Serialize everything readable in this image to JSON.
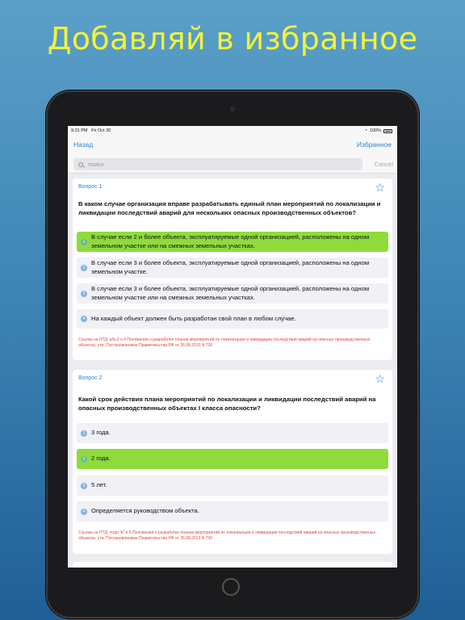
{
  "promo": {
    "title": "Добавляй в избранное"
  },
  "status_bar": {
    "time": "9:31 PM",
    "date": "Fri Oct 30",
    "battery": "100%"
  },
  "nav": {
    "back": "Назад",
    "favorites": "Избранное"
  },
  "search": {
    "placeholder": "поиск",
    "cancel": "Cancel"
  },
  "questions": [
    {
      "number": "Вопрос 1",
      "text": "В каком случае организация вправе разрабатывать единый план мероприятий по локализации и ликвидации последствий аварий для нескольких опасных производственных объектов?",
      "answers": [
        {
          "n": "1",
          "text": "В случае если 2 и более объекта, эксплуатируемые одной организацией, расположены на одном земельном участке или на смежных земельных участках.",
          "correct": true
        },
        {
          "n": "2",
          "text": "В случае если 3 и более объекта, эксплуатируемые одной организацией, расположены на одном земельном участке.",
          "correct": false
        },
        {
          "n": "3",
          "text": "В случае если 3 и более объекта, эксплуатируемые одной организацией, расположены на одном земельном участке или на смежных земельных участках.",
          "correct": false
        },
        {
          "n": "4",
          "text": "На каждый объект должен быть разработан свой план в любом случае.",
          "correct": false
        }
      ],
      "reference": "Ссылка на НТД: абз.2 п.4 Положения о разработке планов мероприятий по локализации и ликвидации последствий аварий на опасных производственных объектах, утв. Постановлением Правительства РФ от 26.08.2013 N 730"
    },
    {
      "number": "Вопрос 2",
      "text": "Какой срок действия плана мероприятий по локализации и ликвидации последствий аварий на опасных производственных объектах I класса опасности?",
      "answers": [
        {
          "n": "1",
          "text": "3 года.",
          "correct": false
        },
        {
          "n": "2",
          "text": "2 года.",
          "correct": true
        },
        {
          "n": "3",
          "text": "5 лет.",
          "correct": false
        },
        {
          "n": "4",
          "text": "Определяется руководством объекта.",
          "correct": false
        }
      ],
      "reference": "Ссылка на НТД: подп.\"в\" п.5 Положения о разработке планов мероприятий по локализации и ликвидации последствий аварий на опасных производственных объектах, утв. Постановлением Правительства РФ от 26.08.2013 N 730"
    }
  ]
}
